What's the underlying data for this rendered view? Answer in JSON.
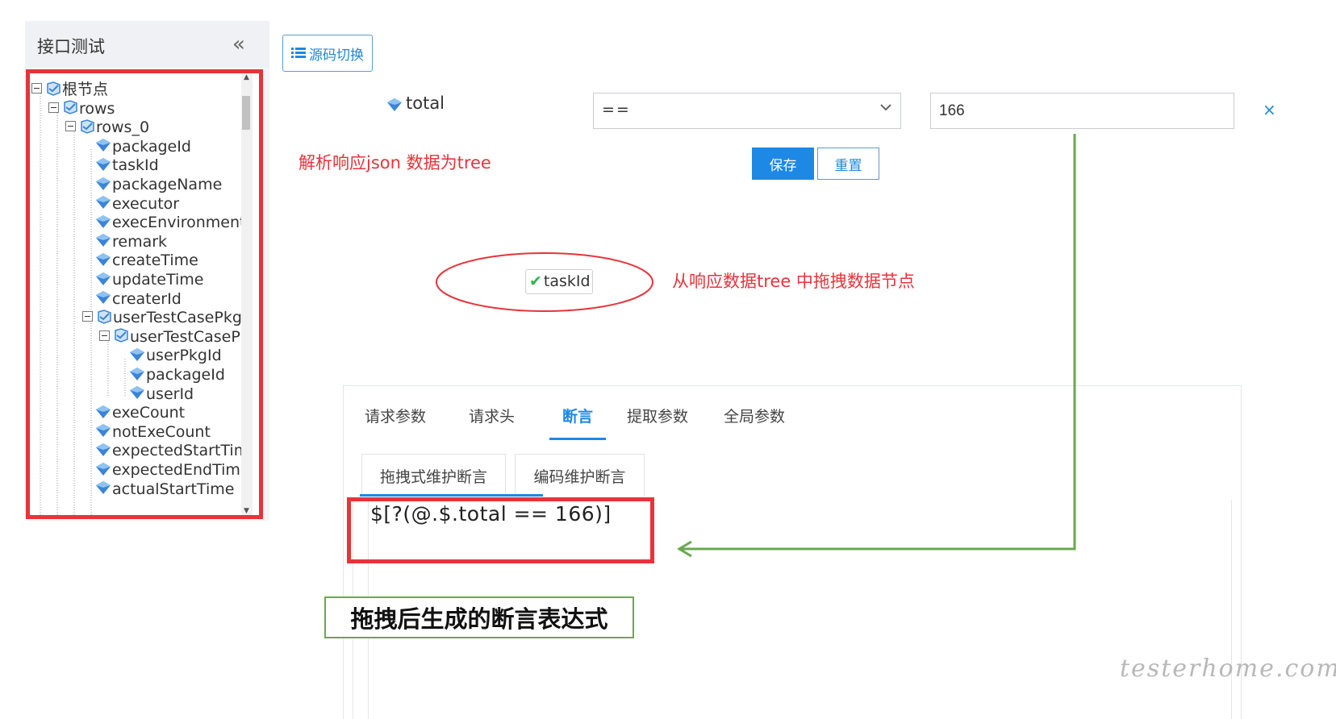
{
  "sidebar": {
    "title": "接口测试",
    "collapse_glyph": "«",
    "tree": [
      {
        "label": "根节点",
        "depth": 0,
        "toggle": true,
        "icon": "folder-icon"
      },
      {
        "label": "rows",
        "depth": 1,
        "toggle": true,
        "icon": "folder-icon"
      },
      {
        "label": "rows_0",
        "depth": 2,
        "toggle": true,
        "icon": "folder-icon"
      },
      {
        "label": "packageId",
        "depth": 3,
        "toggle": false,
        "icon": "field-icon"
      },
      {
        "label": "taskId",
        "depth": 3,
        "toggle": false,
        "icon": "field-icon"
      },
      {
        "label": "packageName",
        "depth": 3,
        "toggle": false,
        "icon": "field-icon"
      },
      {
        "label": "executor",
        "depth": 3,
        "toggle": false,
        "icon": "field-icon"
      },
      {
        "label": "execEnvironment",
        "depth": 3,
        "toggle": false,
        "icon": "field-icon"
      },
      {
        "label": "remark",
        "depth": 3,
        "toggle": false,
        "icon": "field-icon"
      },
      {
        "label": "createTime",
        "depth": 3,
        "toggle": false,
        "icon": "field-icon"
      },
      {
        "label": "updateTime",
        "depth": 3,
        "toggle": false,
        "icon": "field-icon"
      },
      {
        "label": "createrId",
        "depth": 3,
        "toggle": false,
        "icon": "field-icon"
      },
      {
        "label": "userTestCasePkgs",
        "depth": 3,
        "toggle": true,
        "icon": "folder-icon"
      },
      {
        "label": "userTestCasePk",
        "depth": 4,
        "toggle": true,
        "icon": "folder-icon"
      },
      {
        "label": "userPkgId",
        "depth": 5,
        "toggle": false,
        "icon": "field-icon"
      },
      {
        "label": "packageId",
        "depth": 5,
        "toggle": false,
        "icon": "field-icon"
      },
      {
        "label": "userId",
        "depth": 5,
        "toggle": false,
        "icon": "field-icon"
      },
      {
        "label": "exeCount",
        "depth": 3,
        "toggle": false,
        "icon": "field-icon"
      },
      {
        "label": "notExeCount",
        "depth": 3,
        "toggle": false,
        "icon": "field-icon"
      },
      {
        "label": "expectedStartTim",
        "depth": 3,
        "toggle": false,
        "icon": "field-icon"
      },
      {
        "label": "expectedEndTime",
        "depth": 3,
        "toggle": false,
        "icon": "field-icon"
      },
      {
        "label": "actualStartTime",
        "depth": 3,
        "toggle": false,
        "icon": "field-icon"
      }
    ]
  },
  "toolbar": {
    "switch_label": "源码切换",
    "switch_icon": "list-icon"
  },
  "assertion_row": {
    "field_name": "total",
    "field_icon": "field-icon",
    "operator": "==",
    "value": "166",
    "delete_glyph": "×",
    "delete_icon": "close-icon"
  },
  "actions": {
    "save_label": "保存",
    "reset_label": "重置"
  },
  "annotations": {
    "parse_note": "解析响应json 数据为tree",
    "drag_note": "从响应数据tree 中拖拽数据节点",
    "result_note": "拖拽后生成的断言表达式",
    "arrow_color": "#6aa84f",
    "highlight_color": "#e8333a"
  },
  "drag_chip": {
    "check_glyph": "✔",
    "label": "taskId"
  },
  "tabs": [
    {
      "label": "请求参数",
      "active": false
    },
    {
      "label": "请求头",
      "active": false
    },
    {
      "label": "断言",
      "active": true
    },
    {
      "label": "提取参数",
      "active": false
    },
    {
      "label": "全局参数",
      "active": false
    }
  ],
  "subtabs": [
    {
      "label": "拖拽式维护断言",
      "active": true
    },
    {
      "label": "编码维护断言",
      "active": false
    }
  ],
  "editor": {
    "expression": "$[?(@.$.total == 166)]"
  },
  "watermark": "testerhome.com",
  "colors": {
    "accent": "#1e88e5",
    "red": "#e8333a",
    "green": "#6aa84f"
  }
}
